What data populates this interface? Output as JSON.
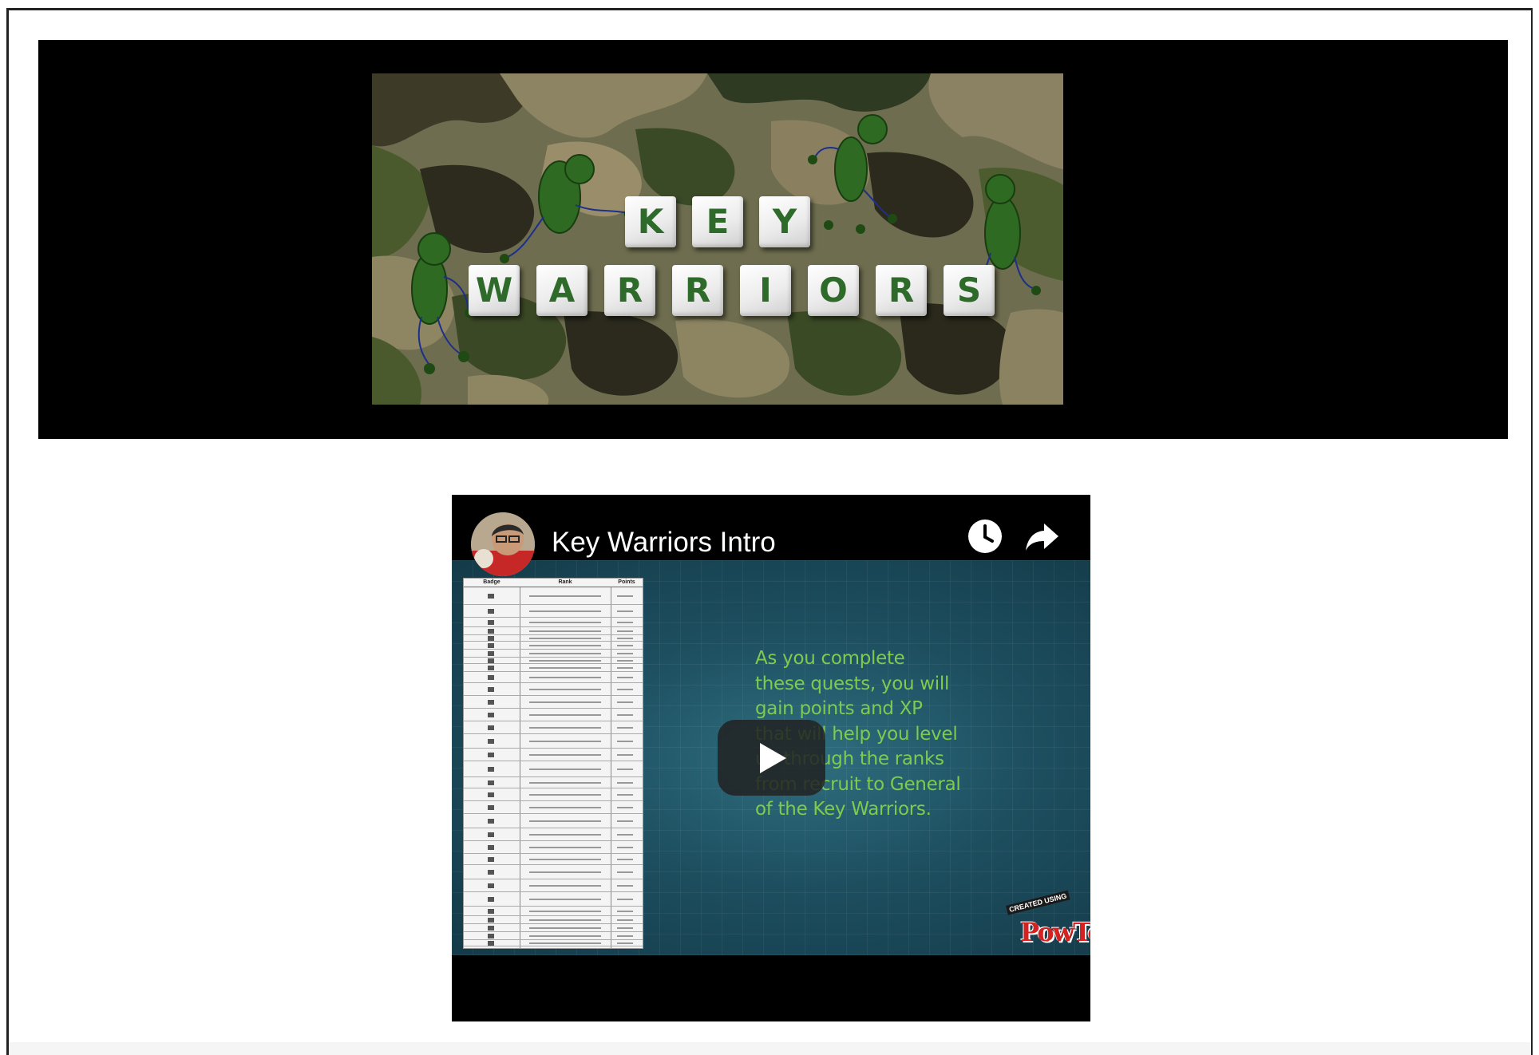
{
  "banner": {
    "logo_word_1": [
      "K",
      "E",
      "Y"
    ],
    "logo_word_2": [
      "W",
      "A",
      "R",
      "R",
      "I",
      "O",
      "R",
      "S"
    ],
    "colors": {
      "background": "#000000",
      "letters": "#2e6b2a"
    }
  },
  "video": {
    "title": "Key Warriors Intro",
    "quest_text": "As you complete\nthese quests, you will\ngain points and XP\nthat will help you level\nup through the ranks\nfrom recruit to General\nof the Key Warriors.",
    "rank_table": {
      "headers": [
        "Badge",
        "Rank",
        "Points"
      ]
    },
    "watermark_small": "CREATED USING",
    "watermark_logo": "PowToon",
    "icons": [
      "channel-avatar",
      "watch-later-icon",
      "share-icon",
      "play-icon"
    ],
    "colors": {
      "quest_text": "#7ecb4f",
      "slide_bg": "#1d4f60"
    }
  }
}
